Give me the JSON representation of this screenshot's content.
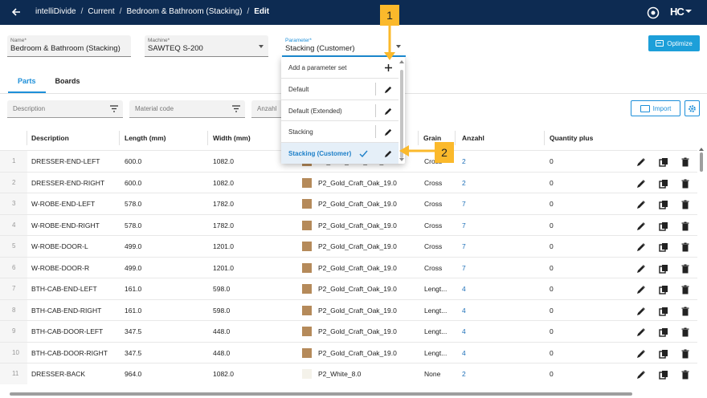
{
  "header": {
    "breadcrumbs": [
      "intelliDivide",
      "Current",
      "Bedroom & Bathroom (Stacking)"
    ],
    "current": "Edit",
    "separator": "/",
    "logo_text": "HC"
  },
  "form": {
    "name": {
      "label": "Name*",
      "value": "Bedroom & Bathroom (Stacking)"
    },
    "machine": {
      "label": "Machine*",
      "value": "SAWTEQ S-200"
    },
    "parameter": {
      "label": "Parameter*",
      "value": "Stacking (Customer)"
    }
  },
  "optimize_label": "Optimize",
  "tabs": [
    "Parts",
    "Boards"
  ],
  "filters": {
    "description": "Description",
    "material": "Material code",
    "anzahl": "Anzahl"
  },
  "import_label": "Import",
  "columns": [
    "Description",
    "Length (mm)",
    "Width (mm)",
    "Grain",
    "Anzahl",
    "Quantity plus"
  ],
  "rows": [
    {
      "n": "1",
      "desc": "DRESSER-END-LEFT",
      "len": "600.0",
      "wid": "1082.0",
      "mat": "P2_Gold_Craft_Oak_19.0",
      "grain": "Cross",
      "qty": "2",
      "plus": "0",
      "swatch": "oak"
    },
    {
      "n": "2",
      "desc": "DRESSER-END-RIGHT",
      "len": "600.0",
      "wid": "1082.0",
      "mat": "P2_Gold_Craft_Oak_19.0",
      "grain": "Cross",
      "qty": "2",
      "plus": "0",
      "swatch": "oak"
    },
    {
      "n": "3",
      "desc": "W-ROBE-END-LEFT",
      "len": "578.0",
      "wid": "1782.0",
      "mat": "P2_Gold_Craft_Oak_19.0",
      "grain": "Cross",
      "qty": "7",
      "plus": "0",
      "swatch": "oak"
    },
    {
      "n": "4",
      "desc": "W-ROBE-END-RIGHT",
      "len": "578.0",
      "wid": "1782.0",
      "mat": "P2_Gold_Craft_Oak_19.0",
      "grain": "Cross",
      "qty": "7",
      "plus": "0",
      "swatch": "oak"
    },
    {
      "n": "5",
      "desc": "W-ROBE-DOOR-L",
      "len": "499.0",
      "wid": "1201.0",
      "mat": "P2_Gold_Craft_Oak_19.0",
      "grain": "Cross",
      "qty": "7",
      "plus": "0",
      "swatch": "oak"
    },
    {
      "n": "6",
      "desc": "W-ROBE-DOOR-R",
      "len": "499.0",
      "wid": "1201.0",
      "mat": "P2_Gold_Craft_Oak_19.0",
      "grain": "Cross",
      "qty": "7",
      "plus": "0",
      "swatch": "oak"
    },
    {
      "n": "7",
      "desc": "BTH-CAB-END-LEFT",
      "len": "161.0",
      "wid": "598.0",
      "mat": "P2_Gold_Craft_Oak_19.0",
      "grain": "Lengt...",
      "qty": "4",
      "plus": "0",
      "swatch": "oak"
    },
    {
      "n": "8",
      "desc": "BTH-CAB-END-RIGHT",
      "len": "161.0",
      "wid": "598.0",
      "mat": "P2_Gold_Craft_Oak_19.0",
      "grain": "Lengt...",
      "qty": "4",
      "plus": "0",
      "swatch": "oak"
    },
    {
      "n": "9",
      "desc": "BTH-CAB-DOOR-LEFT",
      "len": "347.5",
      "wid": "448.0",
      "mat": "P2_Gold_Craft_Oak_19.0",
      "grain": "Lengt...",
      "qty": "4",
      "plus": "0",
      "swatch": "oak"
    },
    {
      "n": "10",
      "desc": "BTH-CAB-DOOR-RIGHT",
      "len": "347.5",
      "wid": "448.0",
      "mat": "P2_Gold_Craft_Oak_19.0",
      "grain": "Lengt...",
      "qty": "4",
      "plus": "0",
      "swatch": "oak"
    },
    {
      "n": "11",
      "desc": "DRESSER-BACK",
      "len": "964.0",
      "wid": "1082.0",
      "mat": "P2_White_8.0",
      "grain": "None",
      "qty": "2",
      "plus": "0",
      "swatch": "white"
    }
  ],
  "dropdown": {
    "add_label": "Add a parameter set",
    "items": [
      {
        "label": "Default",
        "selected": false
      },
      {
        "label": "Default (Extended)",
        "selected": false
      },
      {
        "label": "Stacking",
        "selected": false
      },
      {
        "label": "Stacking (Customer)",
        "selected": true
      }
    ]
  },
  "callouts": [
    "1",
    "2"
  ],
  "colors": {
    "header_bg": "#0d2b52",
    "accent": "#1d9fd9",
    "callout": "#fbb92b",
    "oak_swatch": "#b58a5a",
    "white_swatch": "#f4f2ea"
  }
}
